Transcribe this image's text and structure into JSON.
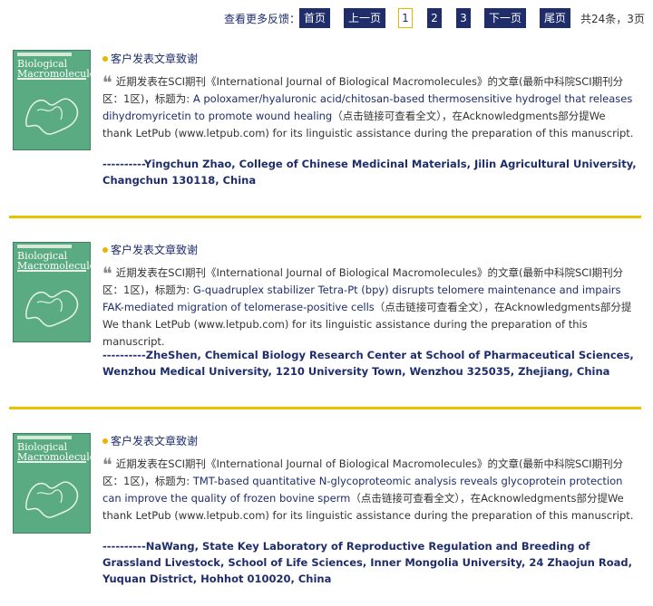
{
  "pager": {
    "label": "查看更多反馈：",
    "first": "首页",
    "prev": "上一页",
    "pages": [
      "1",
      "2",
      "3"
    ],
    "current": "1",
    "next": "下一页",
    "last": "尾页",
    "total": "共24条，3页"
  },
  "entries": [
    {
      "heading": "客户发表文章致谢",
      "prefix": "近期发表在SCI期刊《International Journal of Biological Macromolecules》的文章(最新中科院SCI期刊分区：1区)，标题为: ",
      "title": "A poloxamer/hyaluronic acid/chitosan-based thermosensitive hydrogel that releases dihydromyricetin to promote wound healing",
      "suffix": "（点击链接可查看全文），在Acknowledgments部分提We thank LetPub (www.letpub.com) for its linguistic assistance during the preparation of this manuscript.",
      "author": "----------Yingchun Zhao, College of Chinese Medicinal Materials, Jilin Agricultural University, Changchun 130118, China"
    },
    {
      "heading": "客户发表文章致谢",
      "prefix": "近期发表在SCI期刊《International Journal of Biological Macromolecules》的文章(最新中科院SCI期刊分区：1区)，标题为: ",
      "title": "G-quadruplex stabilizer Tetra-Pt (bpy) disrupts telomere maintenance and impairs FAK-mediated migration of telomerase-positive cells",
      "suffix": "（点击链接可查看全文），在Acknowledgments部分提We thank LetPub (www.letpub.com) for its linguistic assistance during the preparation of this manuscript.",
      "author": "----------ZheShen, Chemical Biology Research Center at School of Pharmaceutical Sciences, Wenzhou Medical University, 1210 University Town, Wenzhou 325035, Zhejiang, China"
    },
    {
      "heading": "客户发表文章致谢",
      "prefix": "近期发表在SCI期刊《International Journal of Biological Macromolecules》的文章(最新中科院SCI期刊分区：1区)，标题为: ",
      "title": "TMT-based quantitative N-glycoproteomic analysis reveals glycoprotein protection can improve the quality of frozen bovine sperm",
      "suffix": "（点击链接可查看全文），在Acknowledgments部分提We thank LetPub (www.letpub.com) for its linguistic assistance during the preparation of this manuscript.",
      "author": "----------NaWang, State Key Laboratory of Reproductive Regulation and Breeding of Grassland Livestock, School of Life Sciences, Inner Mongolia University, 24 Zhaojun Road, Yuquan District, Hohhot 010020, China"
    }
  ],
  "cover": {
    "title": "Biological Macromolecules"
  },
  "colors": {
    "navy": "#1f2d6b",
    "gold": "#e8c200",
    "cover_green": "#5bab82"
  }
}
